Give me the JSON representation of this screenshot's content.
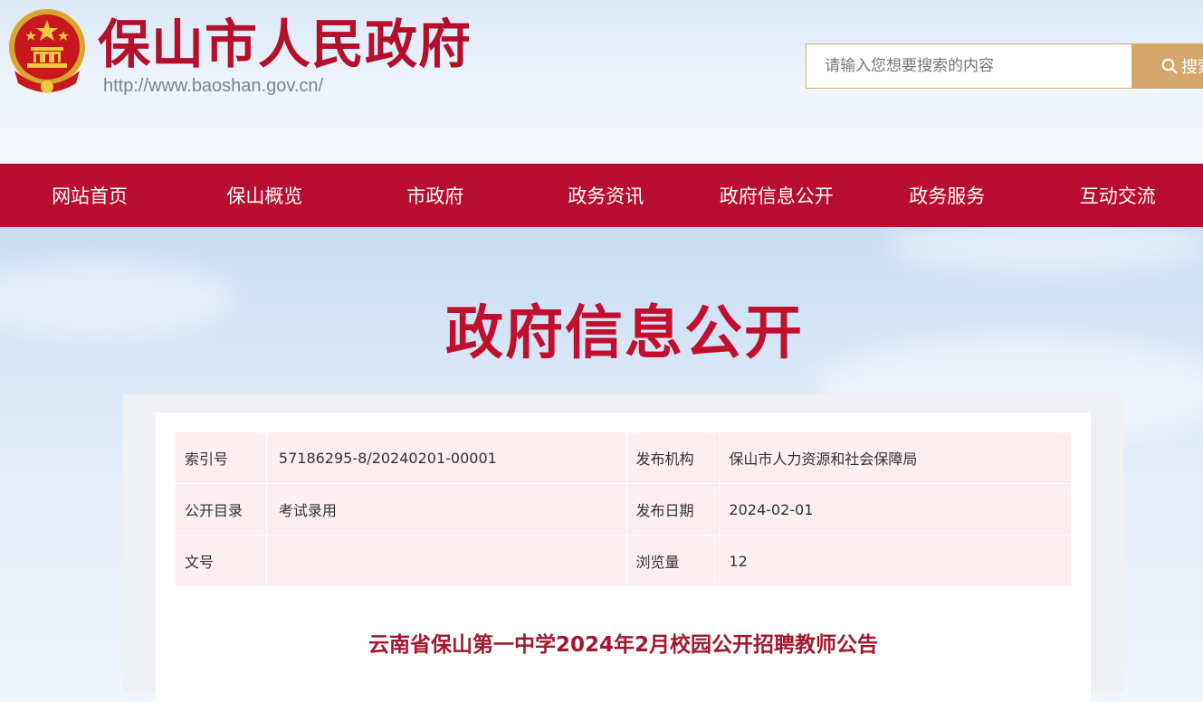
{
  "header": {
    "site_title": "保山市人民政府",
    "site_url": "http://www.baoshan.gov.cn/",
    "emblem_icon": "national-emblem-icon"
  },
  "search": {
    "placeholder": "请输入您想要搜索的内容",
    "value": "",
    "button_label": "搜索",
    "icon": "search-icon"
  },
  "nav": {
    "items": [
      {
        "label": "网站首页"
      },
      {
        "label": "保山概览"
      },
      {
        "label": "市政府"
      },
      {
        "label": "政务资讯"
      },
      {
        "label": "政府信息公开"
      },
      {
        "label": "政务服务"
      },
      {
        "label": "互动交流"
      }
    ]
  },
  "hero": {
    "title": "政府信息公开"
  },
  "meta": {
    "rows": [
      {
        "label1": "索引号",
        "value1": "57186295-8/20240201-00001",
        "label2": "发布机构",
        "value2": "保山市人力资源和社会保障局"
      },
      {
        "label1": "公开目录",
        "value1": "考试录用",
        "label2": "发布日期",
        "value2": "2024-02-01"
      },
      {
        "label1": "文号",
        "value1": "",
        "label2": "浏览量",
        "value2": "12"
      }
    ]
  },
  "article": {
    "title": "云南省保山第一中学2024年2月校园公开招聘教师公告"
  },
  "colors": {
    "brand_red": "#b80d30",
    "title_red": "#c0102e",
    "search_button": "#d6a76a",
    "meta_row_bg": "#fdeef1"
  }
}
